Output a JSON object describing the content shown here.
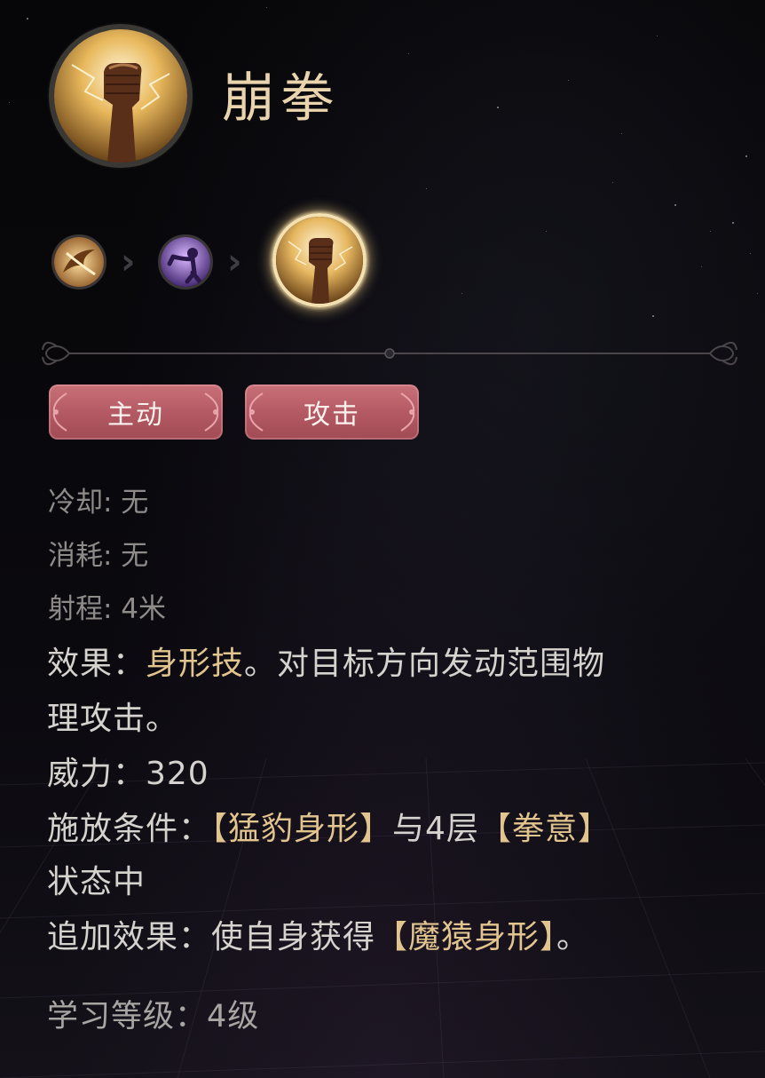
{
  "skill": {
    "name": "崩拳",
    "icon": "fist-lightning-icon"
  },
  "chain": [
    {
      "icon": "leopard-claw-icon",
      "current": false
    },
    {
      "icon": "ape-stance-icon",
      "current": false
    },
    {
      "icon": "fist-lightning-icon",
      "current": true
    }
  ],
  "tags": [
    "主动",
    "攻击"
  ],
  "stats": {
    "cooldown": "冷却: 无",
    "cost": "消耗: 无",
    "range": "射程: 4米"
  },
  "effect": {
    "label": "效果：",
    "highlight": "身形技",
    "text1": "。对目标方向发动范围物",
    "text2": "理攻击。"
  },
  "power": "威力：320",
  "condition": {
    "label": "施放条件：",
    "hl1": "【猛豹身形】",
    "mid": "与4层",
    "hl2": "【拳意】",
    "text2": "状态中"
  },
  "bonus": {
    "label": "追加效果：使自身获得",
    "hl": "【魔猿身形】",
    "end": "。"
  },
  "learn_level": "学习等级：4级",
  "colors": {
    "title": "#e9d4ad",
    "highlight": "#e2c48e",
    "tag": "#b45a64",
    "text": "#d6d3cf",
    "dim_text": "#8e8b89"
  }
}
